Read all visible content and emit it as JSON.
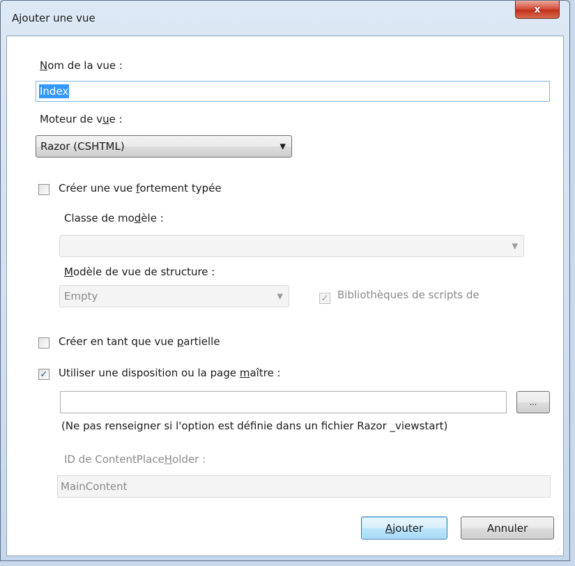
{
  "window": {
    "title": "Ajouter une vue",
    "close_glyph": "x"
  },
  "view_name": {
    "label_u": "N",
    "label_rest": "om de la vue :",
    "value": "Index"
  },
  "engine": {
    "label_pre": "Moteur de v",
    "label_u": "u",
    "label_post": "e :",
    "selected": "Razor (CSHTML)"
  },
  "strongly_typed": {
    "label_pre": "Créer une vue ",
    "label_u": "f",
    "label_post": "ortement typée",
    "checked": false
  },
  "model_class": {
    "label_pre": "Classe de mo",
    "label_u": "d",
    "label_post": "èle :",
    "value": ""
  },
  "scaffold": {
    "label_u": "M",
    "label_rest": "odèle de vue de structure :",
    "selected": "Empty"
  },
  "script_libs": {
    "label": "Bibliothèques de scripts de",
    "checked": true
  },
  "partial": {
    "label_pre": "Créer en tant que vue ",
    "label_u": "p",
    "label_post": "artielle",
    "checked": false
  },
  "layout": {
    "label_pre": "Utiliser une disposition ou la page ",
    "label_u": "m",
    "label_post": "aître :",
    "checked": true,
    "value": "",
    "browse_label": "...",
    "hint": "(Ne pas renseigner si l'option est définie dans un fichier Razor _viewstart)"
  },
  "placeholder_id": {
    "label_pre": "ID de ContentPlace",
    "label_u": "H",
    "label_post": "older :",
    "value": "MainContent"
  },
  "buttons": {
    "add_u": "A",
    "add_rest": "jouter",
    "cancel": "Annuler"
  },
  "icons": {
    "dropdown": "chevron-down-icon",
    "check": "checkmark-icon"
  }
}
